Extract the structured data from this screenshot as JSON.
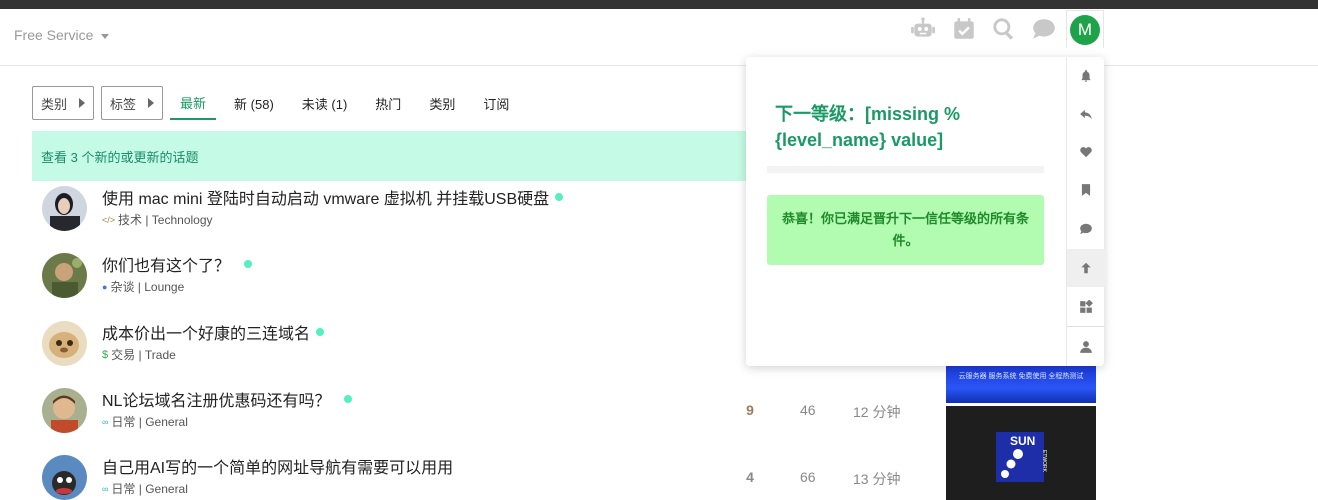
{
  "header": {
    "site_name": "Free Service",
    "icons": [
      "robot-icon",
      "calendar-check-icon",
      "search-icon",
      "chat-icon"
    ],
    "avatar_letter": "M",
    "avatar_color": "#1fa34a"
  },
  "nav": {
    "category_dropdown": "类别",
    "tag_dropdown": "标签",
    "tabs": [
      {
        "label": "最新",
        "active": true
      },
      {
        "label": "新 (58)",
        "active": false
      },
      {
        "label": "未读 (1)",
        "active": false
      },
      {
        "label": "热门",
        "active": false
      },
      {
        "label": "类别",
        "active": false
      },
      {
        "label": "订阅",
        "active": false
      }
    ]
  },
  "banner": {
    "text": "查看 3 个新的或更新的话题"
  },
  "topics": [
    {
      "title": "使用 mac mini 登陆时自动启动 vmware 虚拟机 并挂载USB硬盘",
      "category": "技术 | Technology",
      "cat_icon": "code-icon",
      "cat_color": "#b07a3a",
      "replies": "",
      "views": "",
      "activity": ""
    },
    {
      "title": "你们也有这个了？",
      "category": "杂谈 | Lounge",
      "cat_icon": "chat-bubble-icon",
      "cat_color": "#3a7ad8",
      "replies": "",
      "views": "",
      "activity": ""
    },
    {
      "title": "成本价出一个好康的三连域名",
      "category": "交易 | Trade",
      "cat_icon": "dollar-icon",
      "cat_color": "#3aa84a",
      "replies": "",
      "views": "",
      "activity": ""
    },
    {
      "title": "NL论坛域名注册优惠码还有吗？",
      "category": "日常 | General",
      "cat_icon": "chat-dots-icon",
      "cat_color": "#3ab0c0",
      "replies": "9",
      "views": "46",
      "activity": "12 分钟"
    },
    {
      "title": "自己用AI写的一个简单的网址导航有需要可以用用",
      "category": "日常 | General",
      "cat_icon": "chat-dots-icon",
      "cat_color": "#3ab0c0",
      "replies": "4",
      "views": "66",
      "activity": "13 分钟"
    }
  ],
  "user_menu": {
    "next_level": "下一等级：[missing %{level_name} value]",
    "progress": 0,
    "congrats": "恭喜！你已满足晋升下一信任等级的所有条件。",
    "side_icons": [
      "bell-icon",
      "reply-icon",
      "heart-icon",
      "bookmark-icon",
      "chat-icon",
      "arrow-up-icon",
      "widgets-icon",
      "user-icon"
    ]
  },
  "ads": {
    "ad1_text": "云服务器 服务系统 免费使用 全程热测试",
    "ad2_logo": "SUN",
    "ad2_sub": "ETWORK"
  }
}
